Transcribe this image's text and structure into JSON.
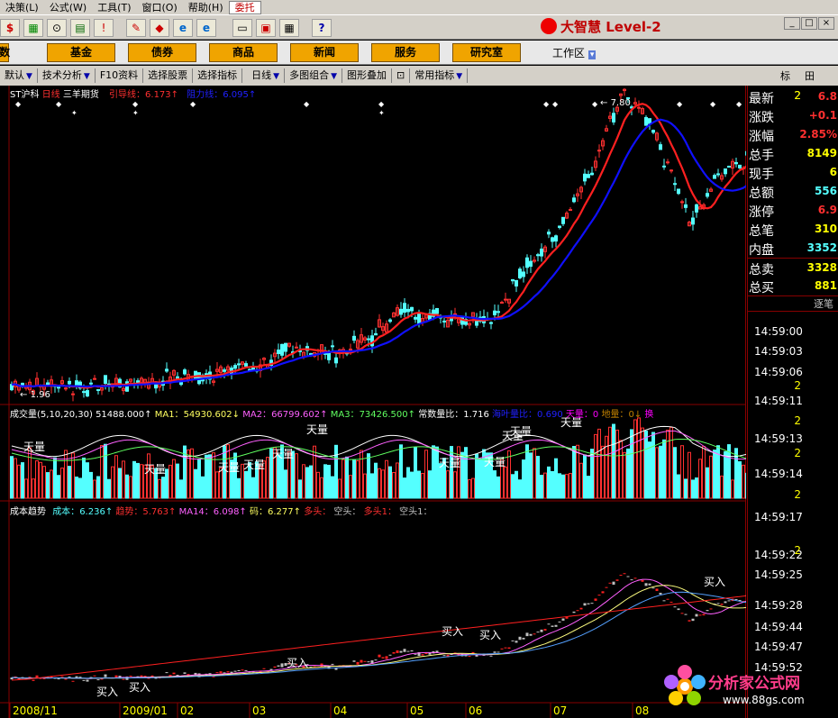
{
  "menu": [
    "决策(L)",
    "公式(W)",
    "工具(T)",
    "窗口(O)",
    "帮助(H)",
    "委托"
  ],
  "brand": "大智慧 Level-2",
  "window_buttons": [
    "_",
    "□",
    "×"
  ],
  "nav_buttons": [
    "数",
    "基金",
    "债券",
    "商品",
    "新闻",
    "服务",
    "研究室"
  ],
  "workarea_label": "工作区",
  "func_items": [
    "默认",
    "技术分析",
    "F10资料",
    "选择股票",
    "选择指标",
    "日线",
    "多图组合",
    "图形叠加",
    "常用指标"
  ],
  "func_right": [
    "标",
    "田"
  ],
  "main_chart": {
    "stock": "ST沪科",
    "period": "日线",
    "extra": "三羊期货",
    "l1": "引导线：",
    "v1": "6.173↑",
    "l2": "阻力线：",
    "v2": "6.095↑",
    "low_label": "1.96",
    "high_label": "7.80"
  },
  "vol_legend": {
    "name": "成交量(5,10,20,30)",
    "v0": "51488.000↑",
    "ma1l": "MA1：",
    "ma1": "54930.602↓",
    "ma2l": "MA2：",
    "ma2": "66799.602↑",
    "ma3l": "MA3：",
    "ma3": "73426.500↑",
    "r1l": "常数量比：",
    "r1": "1.716",
    "r2l": "海叶量比：",
    "r2": "0.690",
    "t1l": "天量：",
    "t1": "0",
    "t2l": "地量：",
    "t2": "0↓",
    "tail": "换"
  },
  "cost_legend": {
    "name": "成本趋势",
    "a1": "成本：",
    "v1": "6.236↑",
    "a2": "趋势：",
    "v2": "5.763↑",
    "a3": "MA14：",
    "v3": "6.098↑",
    "a4": "码：",
    "v4": "6.277↑",
    "a5": "多头：",
    "a6": "空头：",
    "a7": "多头1：",
    "a8": "空头1："
  },
  "tianliang": "天量",
  "buy_label": "买入",
  "dates": [
    "2008/11",
    "2009/01",
    "02",
    "03",
    "04",
    "05",
    "06",
    "07",
    "08"
  ],
  "quote": [
    {
      "k": "最新",
      "v": "6.8"
    },
    {
      "k": "涨跌",
      "v": "+0.1"
    },
    {
      "k": "涨幅",
      "v": "2.85%"
    },
    {
      "k": "总手",
      "v": "8149"
    },
    {
      "k": "现手",
      "v": "6"
    },
    {
      "k": "总额",
      "v": "556"
    },
    {
      "k": "涨停",
      "v": "6.9"
    },
    {
      "k": "总笔",
      "v": "310"
    },
    {
      "k": "内盘",
      "v": "3352"
    },
    {
      "k": "总卖",
      "v": "3328"
    },
    {
      "k": "总买",
      "v": "881"
    }
  ],
  "quote_tab": "逐笔",
  "ticks": [
    {
      "t": "14:59:00",
      "n": ""
    },
    {
      "t": "14:59:03",
      "n": ""
    },
    {
      "t": "14:59:06",
      "n": "2"
    },
    {
      "t": "14:59:11",
      "n": "2"
    },
    {
      "t": "14:59:13",
      "n": "2"
    },
    {
      "t": "14:59:14",
      "n": "2"
    },
    {
      "t": "14:59:17",
      "n": "2"
    },
    {
      "t": "14:59:22",
      "n": "2"
    },
    {
      "t": "14:59:25",
      "n": "2"
    },
    {
      "t": "14:59:28",
      "n": ""
    },
    {
      "t": "14:59:44",
      "n": ""
    },
    {
      "t": "14:59:47",
      "n": ""
    },
    {
      "t": "14:59:52",
      "n": ""
    }
  ],
  "watermark": {
    "title": "分析家公式网",
    "url": "www.88gs.com"
  },
  "colors": {
    "red": "#ff3030",
    "cyan": "#54ffff",
    "blue": "#0000ff",
    "yellow": "#ffff00",
    "magenta": "#ff00ff"
  }
}
